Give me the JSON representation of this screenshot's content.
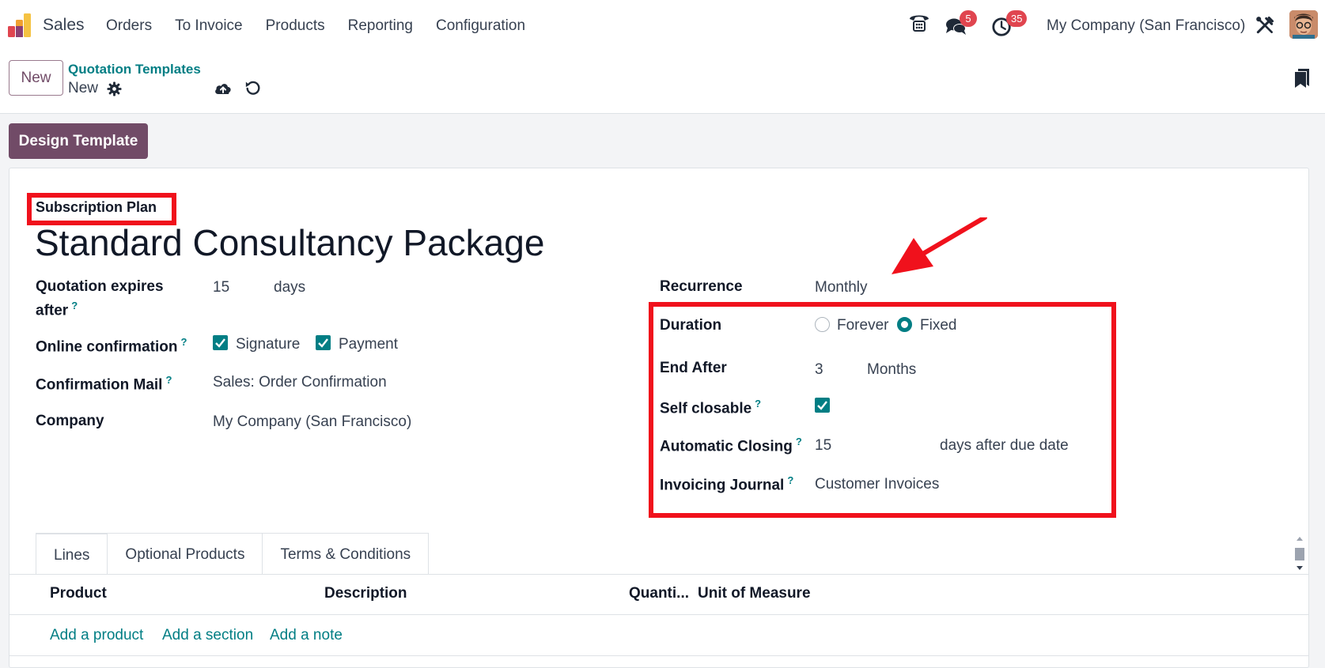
{
  "nav": {
    "app_name": "Sales",
    "menu": [
      "Orders",
      "To Invoice",
      "Products",
      "Reporting",
      "Configuration"
    ],
    "messages_count": "5",
    "activities_count": "35",
    "company": "My Company (San Francisco)"
  },
  "control_panel": {
    "new_button": "New",
    "breadcrumb_parent": "Quotation Templates",
    "breadcrumb_current": "New"
  },
  "status_bar": {
    "design_button": "Design Template"
  },
  "form": {
    "subscription_label": "Subscription Plan",
    "title": "Standard Consultancy Package",
    "left": {
      "expires_label_line1": "Quotation expires",
      "expires_label_line2": "after",
      "expires_value": "15",
      "expires_unit": "days",
      "online_confirmation_label": "Online confirmation",
      "signature_label": "Signature",
      "payment_label": "Payment",
      "confirmation_mail_label": "Confirmation Mail",
      "confirmation_mail_value": "Sales: Order Confirmation",
      "company_label": "Company",
      "company_value": "My Company (San Francisco)"
    },
    "right": {
      "recurrence_label": "Recurrence",
      "recurrence_value": "Monthly",
      "duration_label": "Duration",
      "duration_options": [
        "Forever",
        "Fixed"
      ],
      "duration_selected": "Fixed",
      "end_after_label": "End After",
      "end_after_value": "3",
      "end_after_unit": "Months",
      "self_closable_label": "Self closable",
      "self_closable_checked": true,
      "automatic_closing_label": "Automatic Closing",
      "automatic_closing_value": "15",
      "automatic_closing_unit": "days after due date",
      "invoicing_journal_label": "Invoicing Journal",
      "invoicing_journal_value": "Customer Invoices"
    },
    "help_marker": "?"
  },
  "notebook": {
    "tabs": [
      "Lines",
      "Optional Products",
      "Terms & Conditions"
    ],
    "active_tab": "Lines",
    "columns": [
      "Product",
      "Description",
      "Quanti...",
      "Unit of Measure"
    ],
    "add_links": [
      "Add a product",
      "Add a section",
      "Add a note"
    ]
  },
  "colors": {
    "brand": "#714b67",
    "accent": "#017e84",
    "badge": "#e0454f",
    "annotation": "#f0111c"
  }
}
